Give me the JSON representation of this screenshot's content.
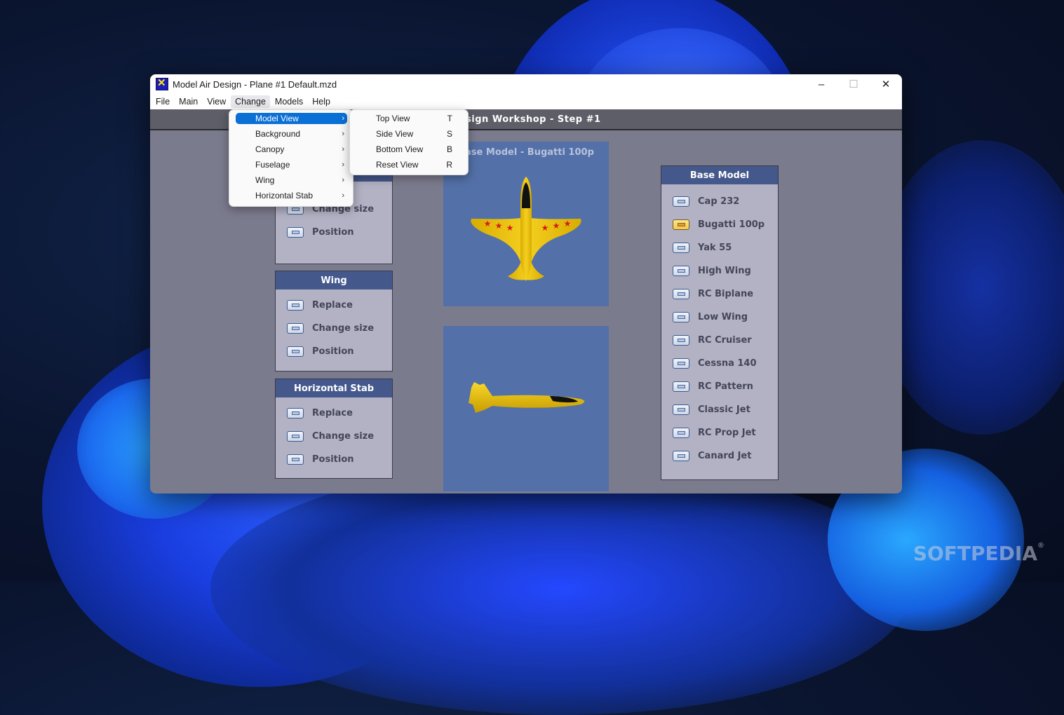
{
  "window": {
    "title": "Model Air Design - Plane #1  Default.mzd",
    "controls": {
      "minimize": "–",
      "maximize": "☐",
      "close": "✕"
    }
  },
  "menubar": [
    "File",
    "Main",
    "View",
    "Change",
    "Models",
    "Help"
  ],
  "change_menu": [
    {
      "label": "Model View",
      "submenu": true,
      "highlighted": true
    },
    {
      "label": "Background",
      "submenu": true
    },
    {
      "label": "Canopy",
      "submenu": true
    },
    {
      "label": "Fuselage",
      "submenu": true
    },
    {
      "label": "Wing",
      "submenu": true
    },
    {
      "label": "Horizontal Stab",
      "submenu": true
    }
  ],
  "model_view_submenu": [
    {
      "label": "Top View",
      "key": "T"
    },
    {
      "label": "Side View",
      "key": "S"
    },
    {
      "label": "Bottom View",
      "key": "B"
    },
    {
      "label": "Reset View",
      "key": "R"
    }
  ],
  "step_bar": {
    "title": "Design Workshop  -  Step #1"
  },
  "panels": {
    "fuselage": {
      "options": [
        "Change size",
        "Position"
      ]
    },
    "wing": {
      "title": "Wing",
      "options": [
        "Replace",
        "Change size",
        "Position"
      ]
    },
    "horizontal_stab": {
      "title": "Horizontal Stab",
      "options": [
        "Replace",
        "Change size",
        "Position"
      ]
    },
    "base_model": {
      "title": "Base Model",
      "selected": "Bugatti 100p",
      "options": [
        "Cap 232",
        "Bugatti 100p",
        "Yak 55",
        "High Wing",
        "RC Biplane",
        "Low Wing",
        "RC Cruiser",
        "Cessna 140",
        "RC Pattern",
        "Classic Jet",
        "RC Prop Jet",
        "Canard Jet"
      ]
    }
  },
  "views": {
    "top_view_title": "Base Model  -  Bugatti 100p",
    "top_view_icon": "airplane-top-view",
    "side_view_icon": "airplane-side-view"
  },
  "colors": {
    "panel_header": "#44588c",
    "view_background": "#5370a8",
    "plane_body": "#f0c808",
    "star": "#d81818",
    "menu_highlight": "#0a70d6"
  },
  "watermark": "SOFTPEDIA"
}
